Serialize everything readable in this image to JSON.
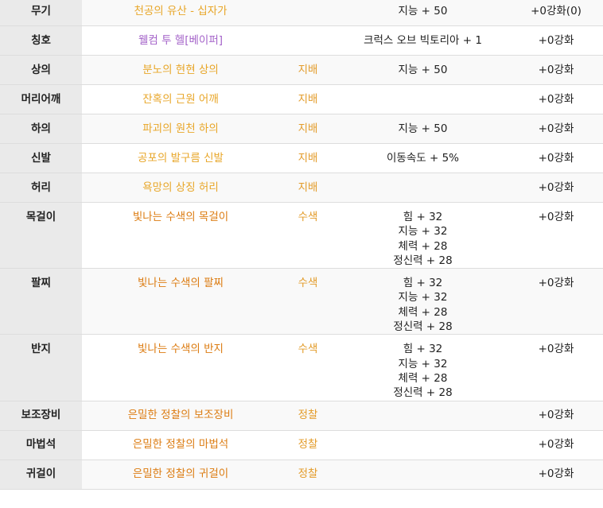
{
  "colors": {
    "name_gold": "#e8a628",
    "name_orange": "#dc7c12",
    "name_purple": "#a463c9",
    "set_label": "#e39c2b",
    "slot_bg": "#eaeaea",
    "row_alt_bg": "#f9f9f9",
    "border": "#dddddd"
  },
  "rows": [
    {
      "slot": "무기",
      "name": "천공의 유산 - 십자가",
      "name_color": "#e8a628",
      "set": "",
      "options": [
        "지능 + 50"
      ],
      "enhance": "+0강화(0)"
    },
    {
      "slot": "칭호",
      "name": "웰컴 투 헬[베이퍼]",
      "name_color": "#a463c9",
      "set": "",
      "options": [
        "크럭스 오브 빅토리아 + 1"
      ],
      "enhance": "+0강화"
    },
    {
      "slot": "상의",
      "name": "분노의 현현 상의",
      "name_color": "#e8a628",
      "set": "지배",
      "options": [
        "지능 + 50"
      ],
      "enhance": "+0강화"
    },
    {
      "slot": "머리어깨",
      "name": "잔혹의 근원 어깨",
      "name_color": "#e8a628",
      "set": "지배",
      "options": [],
      "enhance": "+0강화"
    },
    {
      "slot": "하의",
      "name": "파괴의 원천 하의",
      "name_color": "#e8a628",
      "set": "지배",
      "options": [
        "지능 + 50"
      ],
      "enhance": "+0강화"
    },
    {
      "slot": "신발",
      "name": "공포의 발구름 신발",
      "name_color": "#e8a628",
      "set": "지배",
      "options": [
        "이동속도 + 5%"
      ],
      "enhance": "+0강화"
    },
    {
      "slot": "허리",
      "name": "욕망의 상징 허리",
      "name_color": "#e8a628",
      "set": "지배",
      "options": [],
      "enhance": "+0강화"
    },
    {
      "slot": "목걸이",
      "name": "빛나는 수색의 목걸이",
      "name_color": "#dc7c12",
      "set": "수색",
      "options": [
        "힘 + 32",
        "지능 + 32",
        "체력 + 28",
        "정신력 + 28"
      ],
      "enhance": "+0강화"
    },
    {
      "slot": "팔찌",
      "name": "빛나는 수색의 팔찌",
      "name_color": "#dc7c12",
      "set": "수색",
      "options": [
        "힘 + 32",
        "지능 + 32",
        "체력 + 28",
        "정신력 + 28"
      ],
      "enhance": "+0강화"
    },
    {
      "slot": "반지",
      "name": "빛나는 수색의 반지",
      "name_color": "#dc7c12",
      "set": "수색",
      "options": [
        "힘 + 32",
        "지능 + 32",
        "체력 + 28",
        "정신력 + 28"
      ],
      "enhance": "+0강화"
    },
    {
      "slot": "보조장비",
      "name": "은밀한 정찰의 보조장비",
      "name_color": "#dc7c12",
      "set": "정찰",
      "options": [],
      "enhance": "+0강화"
    },
    {
      "slot": "마법석",
      "name": "은밀한 정찰의 마법석",
      "name_color": "#dc7c12",
      "set": "정찰",
      "options": [],
      "enhance": "+0강화"
    },
    {
      "slot": "귀걸이",
      "name": "은밀한 정찰의 귀걸이",
      "name_color": "#dc7c12",
      "set": "정찰",
      "options": [],
      "enhance": "+0강화"
    }
  ]
}
